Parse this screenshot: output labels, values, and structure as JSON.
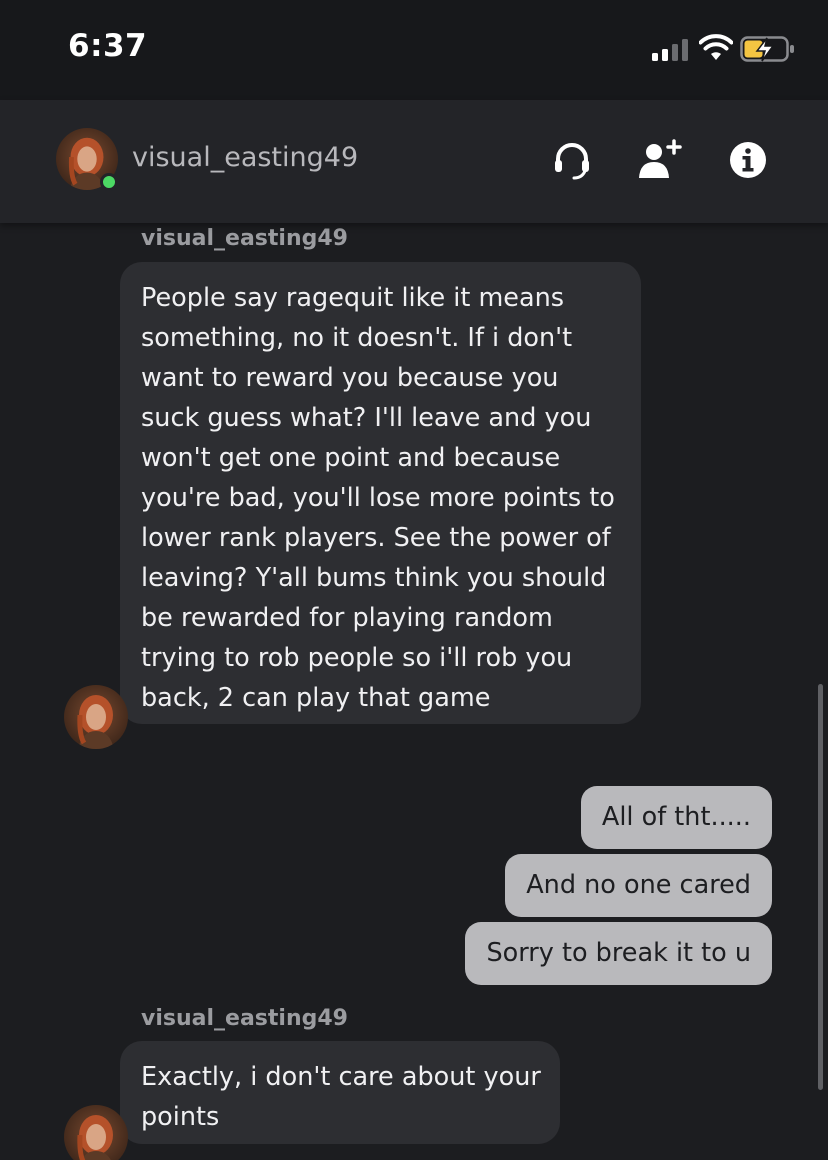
{
  "status_bar": {
    "time": "6:37",
    "icons": [
      "signal-icon",
      "wifi-icon",
      "battery-charging-icon"
    ],
    "battery_color": "#f4c542"
  },
  "header": {
    "contact_name": "visual_easting49",
    "online": true,
    "online_color": "#4cd964",
    "actions": [
      "headset-icon",
      "add-friend-icon",
      "info-icon"
    ]
  },
  "messages": [
    {
      "direction": "incoming",
      "sender": "visual_easting49",
      "lines": [
        "People say ragequit like it means",
        "something, no it doesn't. If i don't",
        "want to reward you because you",
        "suck guess what? I'll leave and you",
        "won't get one point and because",
        "you're bad, you'll lose more points to",
        "lower rank players. See the power of",
        "leaving? Y'all bums think you should",
        "be rewarded for playing random",
        "trying to rob people so i'll rob you",
        "back, 2 can play that game"
      ]
    },
    {
      "direction": "outgoing",
      "text": "All of tht....."
    },
    {
      "direction": "outgoing",
      "text": "And no one cared"
    },
    {
      "direction": "outgoing",
      "text": "Sorry to break it to u"
    },
    {
      "direction": "incoming",
      "sender": "visual_easting49",
      "lines": [
        "Exactly, i don't care about your",
        "points"
      ]
    }
  ]
}
